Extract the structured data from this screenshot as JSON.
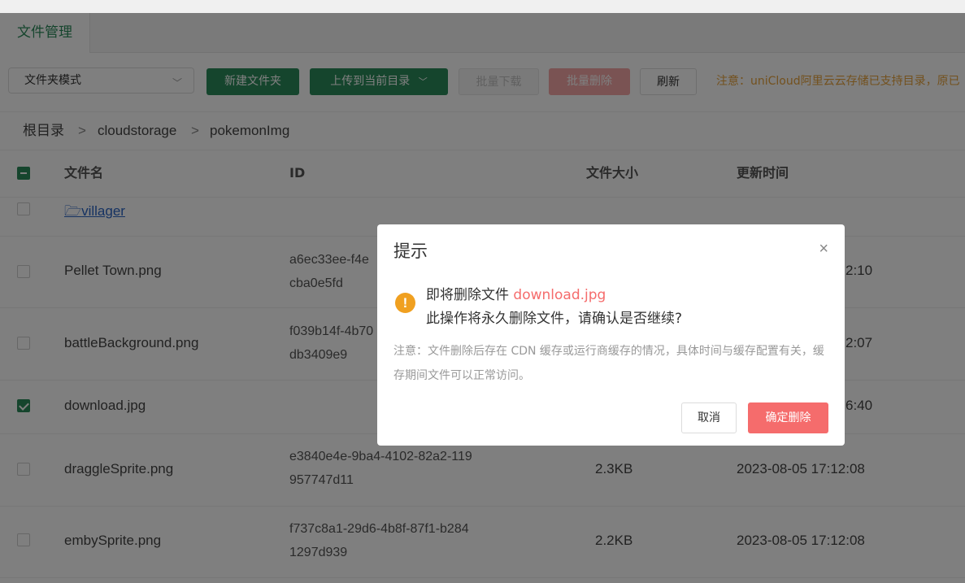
{
  "tabs": {
    "active_label": "文件管理"
  },
  "toolbar": {
    "mode_select_value": "文件夹模式",
    "new_folder_label": "新建文件夹",
    "upload_label": "上传到当前目录",
    "batch_download_label": "批量下载",
    "batch_delete_label": "批量删除",
    "refresh_label": "刷新",
    "notice": "注意：uniCloud阿里云云存储已支持目录，原已"
  },
  "breadcrumb": {
    "items": [
      "根目录",
      "cloudstorage",
      "pokemonImg"
    ],
    "separator": ">"
  },
  "table": {
    "headers": {
      "name": "文件名",
      "id": "ID",
      "size": "文件大小",
      "updated": "更新时间"
    },
    "rows": [
      {
        "name": "villager",
        "type": "folder",
        "checked": false,
        "id_line1": "",
        "id_line2": "",
        "size": "",
        "updated": ""
      },
      {
        "name": "Pellet Town.png",
        "checked": false,
        "id_line1": "a6ec33ee-f4e",
        "id_line2": "cba0e5fd",
        "size": "",
        "updated": "2:10"
      },
      {
        "name": "battleBackground.png",
        "checked": false,
        "id_line1": "f039b14f-4b70",
        "id_line2": "db3409e9",
        "size": "",
        "updated": "2:07"
      },
      {
        "name": "download.jpg",
        "checked": true,
        "id_line1": "",
        "id_line2": "",
        "size": "",
        "updated": "6:40"
      },
      {
        "name": "draggleSprite.png",
        "checked": false,
        "id_line1": "e3840e4e-9ba4-4102-82a2-119",
        "id_line2": "957747d11",
        "size": "2.3KB",
        "updated": "2023-08-05 17:12:08"
      },
      {
        "name": "embySprite.png",
        "checked": false,
        "id_line1": "f737c8a1-29d6-4b8f-87f1-b284",
        "id_line2": "1297d939",
        "size": "2.2KB",
        "updated": "2023-08-05 17:12:08"
      }
    ]
  },
  "dialog": {
    "title": "提示",
    "close_icon": "×",
    "warning_icon": "!",
    "message_prefix": "即将删除文件",
    "file_name": "download.jpg",
    "message_line2": "此操作将永久删除文件，请确认是否继续?",
    "note": "注意：文件删除后存在 CDN 缓存或运行商缓存的情况，具体时间与缓存配置有关，缓存期间文件可以正常访问。",
    "cancel_label": "取消",
    "confirm_label": "确定删除"
  },
  "colors": {
    "primary": "#2b8a5a",
    "danger": "#f56c6c",
    "warning": "#e6a23c",
    "link": "#2a64c4"
  }
}
